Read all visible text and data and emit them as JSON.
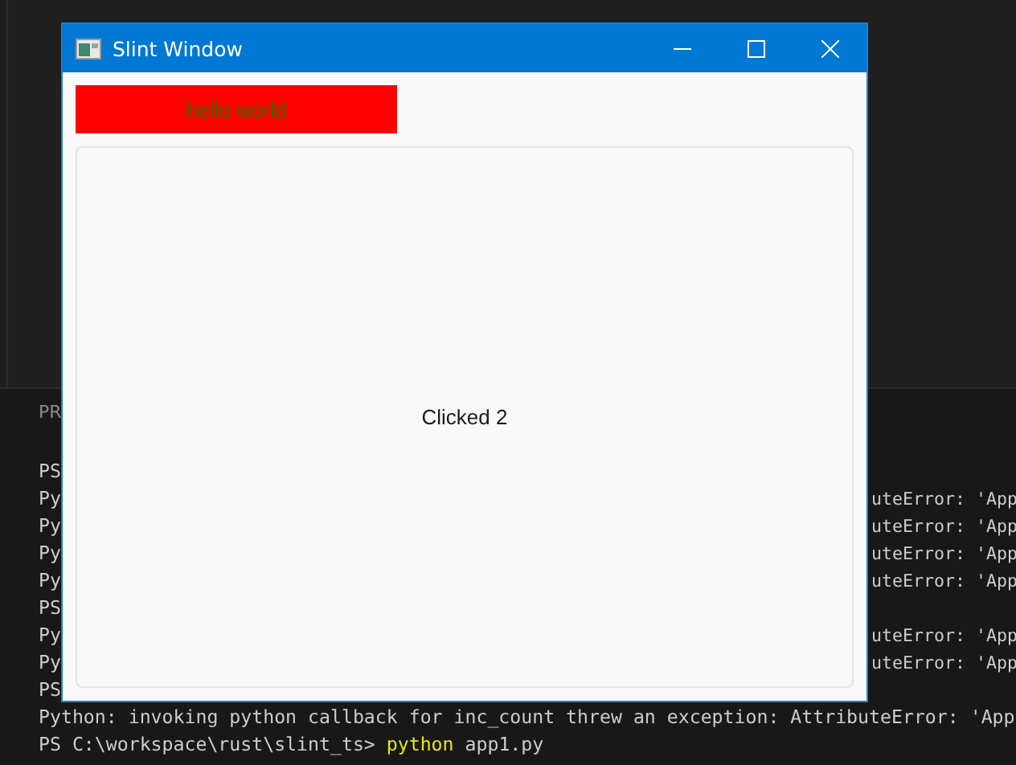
{
  "terminal": {
    "panel_tab": "PR",
    "lines": [
      {
        "kind": "cut",
        "left": "PS"
      },
      {
        "kind": "cut",
        "left": "Py",
        "right": "uteError: 'App"
      },
      {
        "kind": "cut",
        "left": "Py",
        "right": "uteError: 'App"
      },
      {
        "kind": "cut",
        "left": "Py",
        "right": "uteError: 'App"
      },
      {
        "kind": "cut",
        "left": "Py",
        "right": "uteError: 'App"
      },
      {
        "kind": "cut",
        "left": "PS"
      },
      {
        "kind": "cut",
        "left": "Py",
        "right": "uteError: 'App"
      },
      {
        "kind": "cut",
        "left": "Py",
        "right": "uteError: 'App"
      },
      {
        "kind": "cut",
        "left": "PS"
      },
      {
        "kind": "full",
        "text": "Python: invoking python callback for inc_count threw an exception: AttributeError: 'App"
      },
      {
        "kind": "command",
        "prompt": "PS C:\\workspace\\rust\\slint_ts>",
        "command": "python",
        "args": "app1.py"
      }
    ]
  },
  "window": {
    "title": "Slint Window"
  },
  "banner": {
    "text": "hello world"
  },
  "card": {
    "text": "Clicked 2"
  }
}
